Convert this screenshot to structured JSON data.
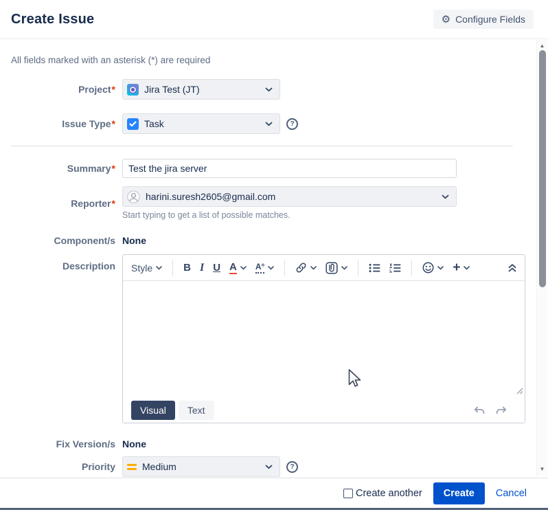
{
  "header": {
    "title": "Create Issue",
    "configure_fields_label": "Configure Fields"
  },
  "form": {
    "required_note": "All fields marked with an asterisk (*) are required",
    "project": {
      "label": "Project",
      "required": "*",
      "value": "Jira Test (JT)"
    },
    "issue_type": {
      "label": "Issue Type",
      "required": "*",
      "value": "Task"
    },
    "summary": {
      "label": "Summary",
      "required": "*",
      "value": "Test the jira server"
    },
    "reporter": {
      "label": "Reporter",
      "required": "*",
      "value": "harini.suresh2605@gmail.com",
      "help": "Start typing to get a list of possible matches."
    },
    "components": {
      "label": "Component/s",
      "value": "None"
    },
    "description": {
      "label": "Description"
    },
    "fix_versions": {
      "label": "Fix Version/s",
      "value": "None"
    },
    "priority": {
      "label": "Priority",
      "value": "Medium"
    }
  },
  "editor": {
    "style_label": "Style",
    "bold_glyph": "B",
    "italic_glyph": "I",
    "underline_glyph": "U",
    "color_glyph": "A",
    "textstyle_glyph": "A°",
    "plus_glyph": "+",
    "tabs": {
      "visual": "Visual",
      "text": "Text"
    }
  },
  "footer": {
    "create_another_label": "Create another",
    "create_label": "Create",
    "cancel_label": "Cancel"
  },
  "icons": {
    "gear": "⚙",
    "help": "?",
    "arrow_up": "▲",
    "arrow_down": "▼"
  },
  "colors": {
    "accent": "#0052CC",
    "title_text": "#172B4D",
    "label_text": "#5E6C84",
    "required_asterisk": "#DE350B",
    "task_icon_blue": "#2684FF",
    "priority_medium_orange": "#FFAB00",
    "visual_tab_bg": "#344563",
    "scroll_thumb": "#8A8F98"
  }
}
